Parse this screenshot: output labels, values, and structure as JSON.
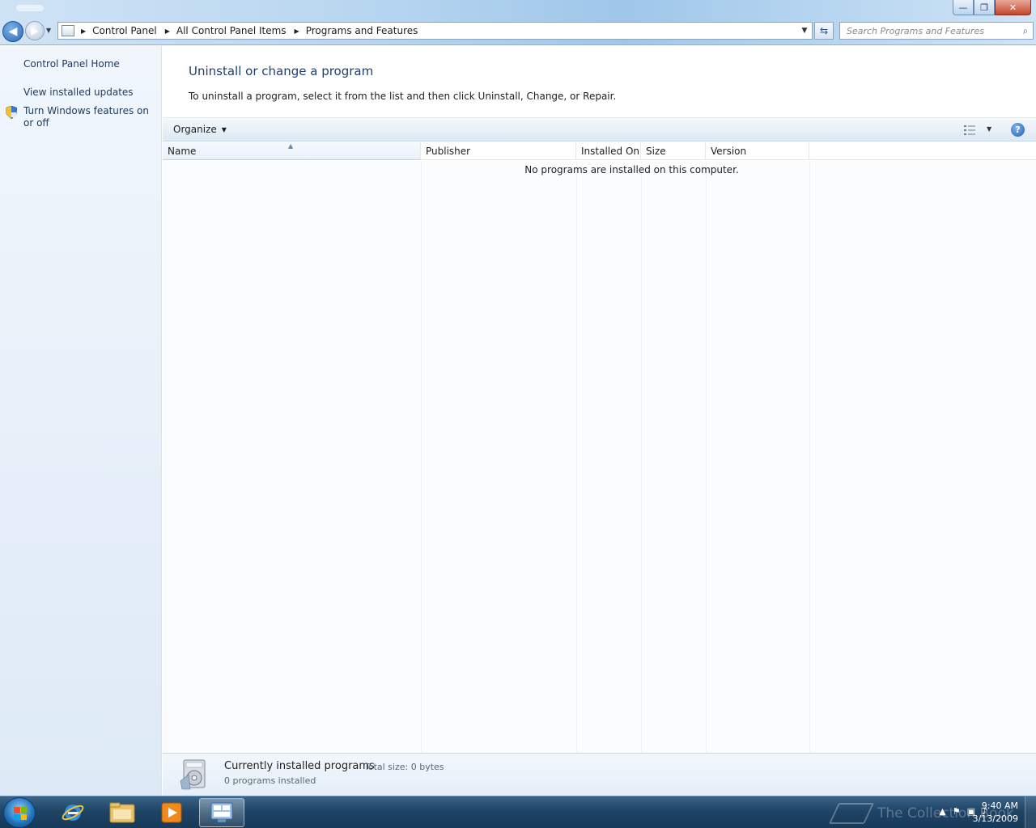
{
  "nav": {
    "breadcrumb": [
      "Control Panel",
      "All Control Panel Items",
      "Programs and Features"
    ],
    "search_placeholder": "Search Programs and Features"
  },
  "window_buttons": {
    "minimize": "—",
    "maximize": "❐",
    "close": "✕"
  },
  "sidebar": {
    "home": "Control Panel Home",
    "items": [
      {
        "label": "View installed updates",
        "icon": ""
      },
      {
        "label": "Turn Windows features on or off",
        "icon": "shield-icon"
      }
    ]
  },
  "main": {
    "heading": "Uninstall or change a program",
    "instructions": "To uninstall a program, select it from the list and then click Uninstall, Change, or Repair.",
    "toolbar": {
      "organize_label": "Organize",
      "help": "?"
    },
    "columns": [
      "Name",
      "Publisher",
      "Installed On",
      "Size",
      "Version"
    ],
    "sorted_column": "Name",
    "empty_message": "No programs are installed on this computer."
  },
  "details": {
    "title": "Currently installed programs",
    "total_size": "Total size: 0 bytes",
    "count": "0 programs installed"
  },
  "taskbar": {
    "apps": [
      "internet-explorer-icon",
      "windows-explorer-icon",
      "media-player-icon",
      "control-panel-icon"
    ],
    "active_app": "control-panel-icon",
    "time": "9:40 AM",
    "date": "3/13/2009"
  },
  "watermark": "The Collection Book",
  "colors": {
    "link": "#1e395b",
    "heading": "#1e3f73",
    "taskbar": "#1f4466"
  }
}
